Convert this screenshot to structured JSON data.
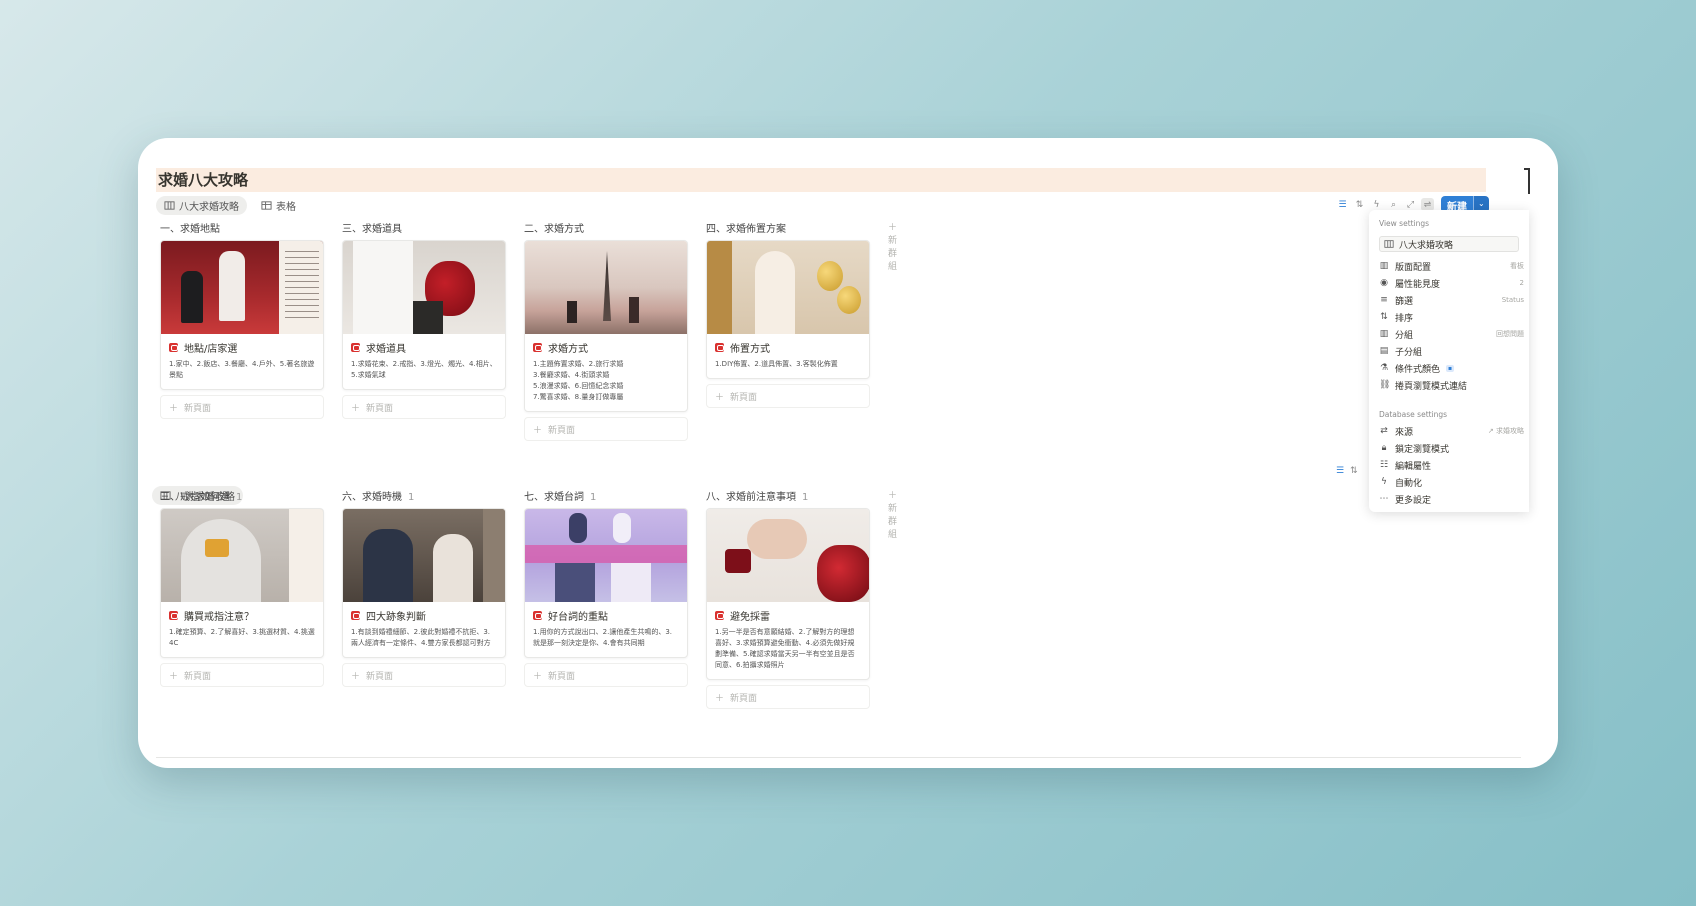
{
  "page": {
    "title": "求婚八大攻略"
  },
  "tabs": [
    {
      "label": "八大求婚攻略",
      "active": true
    },
    {
      "label": "表格",
      "active": false
    }
  ],
  "toolbar": {
    "new_label": "新建"
  },
  "board1": {
    "columns": [
      {
        "title": "一、求婚地點",
        "card": {
          "title": "地點/店家選",
          "body": "1.家中、2.飯店、3.餐廳、4.戶外、5.著名旅遊景點"
        }
      },
      {
        "title": "三、求婚道具",
        "card": {
          "title": "求婚道具",
          "body": "1.求婚花束、2.戒指、3.燈光、燭光、4.相片、5.求婚氣球"
        }
      },
      {
        "title": "二、求婚方式",
        "card": {
          "title": "求婚方式",
          "body": "1.主題佈置求婚、2.旅行求婚\n3.餐廳求婚、4.街頭求婚\n5.浪漫求婚、6.回憶紀念求婚\n7.驚喜求婚、8.量身訂做專屬"
        }
      },
      {
        "title": "四、求婚佈置方案",
        "card": {
          "title": "佈置方式",
          "body": "1.DIY佈置、2.道具佈置、3.客製化佈置"
        }
      }
    ],
    "add_page": "新頁面",
    "add_group": "新群組"
  },
  "board2": {
    "view_label": "八大求婚攻略",
    "columns": [
      {
        "title": "三、戒指如何選",
        "count": "1",
        "card": {
          "title": "購買戒指注意？",
          "body": "1.確定預算、2.了解喜好、3.挑選材質、4.挑選4C"
        }
      },
      {
        "title": "六、求婚時機",
        "count": "1",
        "card": {
          "title": "四大跡象判斷",
          "body": "1.有談到婚禮細節、2.彼此對婚禮不抗拒、3.兩人經濟有一定條件、4.雙方家長都認可對方"
        }
      },
      {
        "title": "七、求婚台詞",
        "count": "1",
        "card": {
          "title": "好台詞的重點",
          "body": "1.用你的方式說出口、2.讓他產生共鳴的、3.就是那一刻決定是你、4.會有共同期"
        }
      },
      {
        "title": "八、求婚前注意事項",
        "count": "1",
        "card": {
          "title": "避免採雷",
          "body": "1.另一半是否有意願結婚、2.了解對方的理想喜好、3.求婚預算避免衝動、4.必須先做好規劃準備、5.確認求婚當天另一半有空並且是否同意、6.拍攝求婚照片"
        }
      }
    ],
    "add_page": "新頁面",
    "add_group": "新群組"
  },
  "panel": {
    "view_settings_label": "View settings",
    "view_name": "八大求婚攻略",
    "rows": [
      {
        "label": "版面配置",
        "value": "看板"
      },
      {
        "label": "屬性能見度",
        "value": "2"
      },
      {
        "label": "篩選",
        "value": "Status"
      },
      {
        "label": "排序",
        "value": ""
      },
      {
        "label": "分組",
        "value": "回想問題"
      },
      {
        "label": "子分組",
        "value": ""
      },
      {
        "label": "條件式顏色",
        "value": ""
      },
      {
        "label": "捲頁瀏覽模式連結",
        "value": ""
      }
    ],
    "database_settings_label": "Database settings",
    "db_rows": [
      {
        "label": "來源",
        "value": "求婚攻略"
      },
      {
        "label": "鎖定瀏覽模式",
        "value": ""
      },
      {
        "label": "編輯屬性",
        "value": ""
      },
      {
        "label": "自動化",
        "value": ""
      },
      {
        "label": "更多設定",
        "value": ""
      }
    ]
  },
  "colors": {
    "accent": "#2f7fd5",
    "title_highlight": "#fbece0",
    "tag_red": "#d9312f"
  }
}
